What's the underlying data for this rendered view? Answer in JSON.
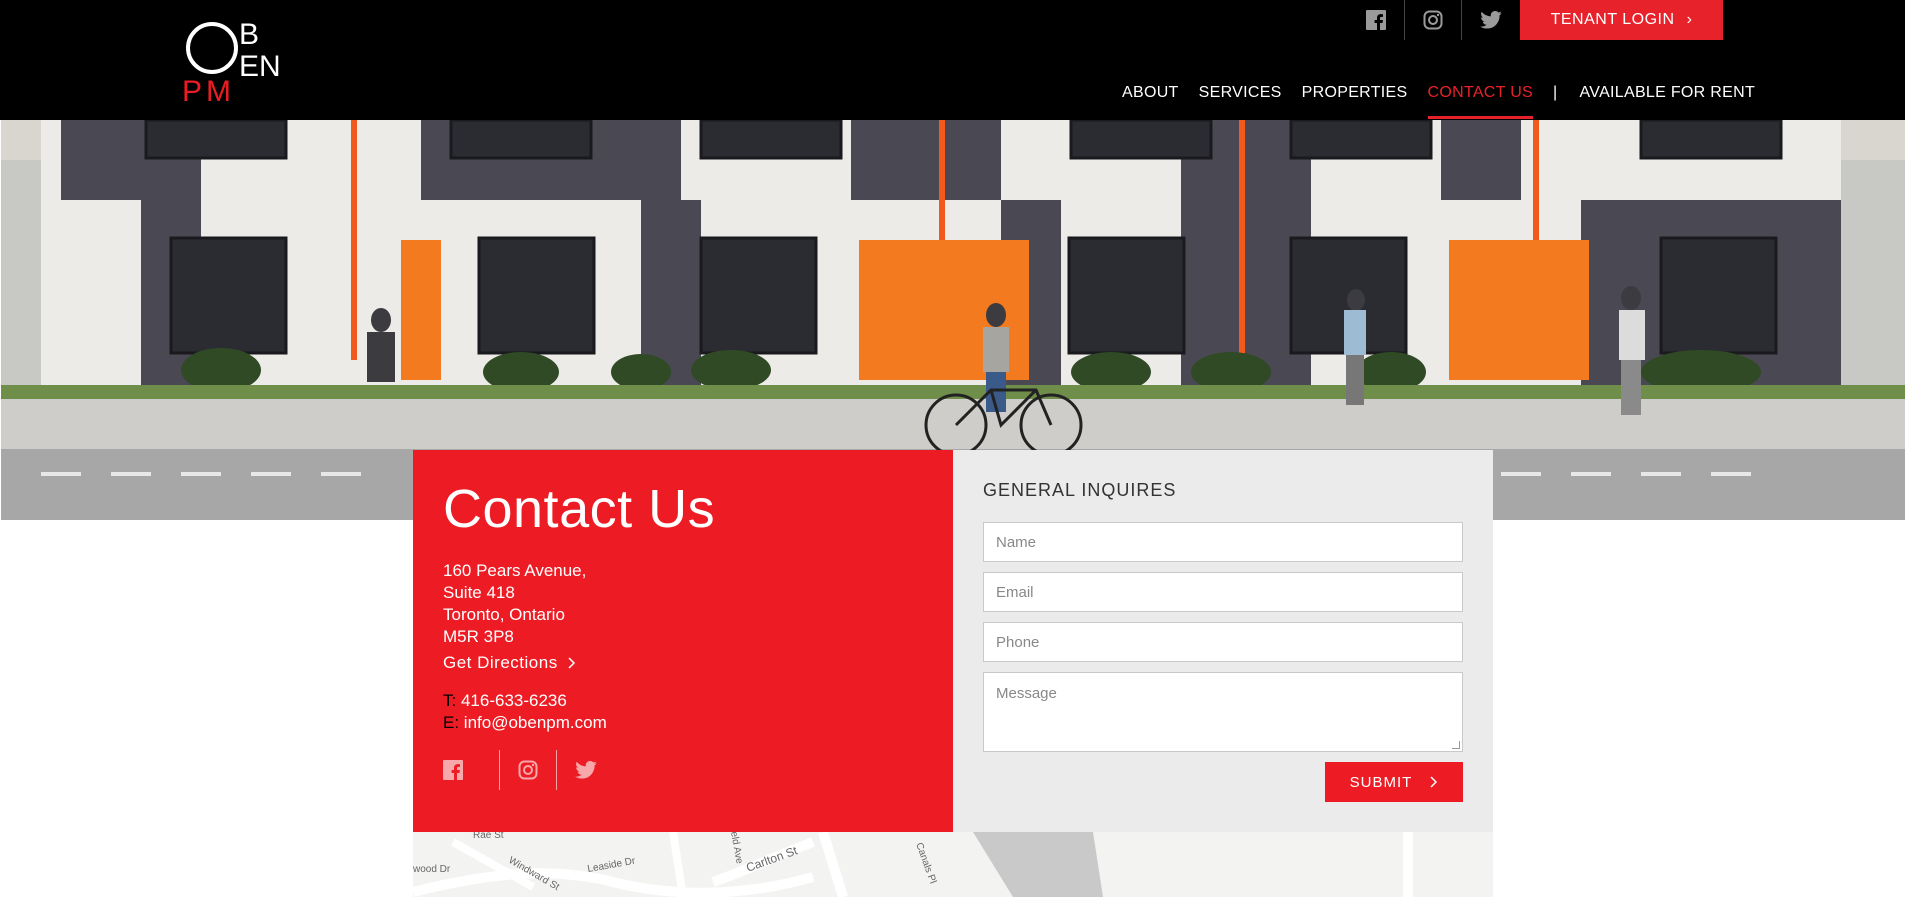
{
  "header": {
    "logo_alt": "OBEN PM",
    "tenant_login": "TENANT LOGIN",
    "social": [
      "facebook-icon",
      "instagram-icon",
      "twitter-icon"
    ],
    "nav": [
      {
        "label": "ABOUT",
        "active": false
      },
      {
        "label": "SERVICES",
        "active": false
      },
      {
        "label": "PROPERTIES",
        "active": false
      },
      {
        "label": "CONTACT US",
        "active": true
      }
    ],
    "nav_separator": "|",
    "nav_extra": "AVAILABLE FOR RENT"
  },
  "contact": {
    "title": "Contact Us",
    "address": [
      "160 Pears Avenue,",
      "Suite 418",
      "Toronto, Ontario",
      "M5R 3P8"
    ],
    "directions": "Get Directions",
    "phone_label": "T:",
    "phone": "416-633-6236",
    "email_label": "E:",
    "email": "info@obenpm.com"
  },
  "form": {
    "heading": "GENERAL INQUIRES",
    "name_placeholder": "Name",
    "email_placeholder": "Email",
    "phone_placeholder": "Phone",
    "message_placeholder": "Message",
    "submit": "SUBMIT"
  },
  "map": {
    "labels": [
      "Rae St",
      "Windward St",
      "Leaside Dr",
      "Carlton St",
      "Canals Pl",
      "wood Dr",
      "eld Ave"
    ]
  },
  "colors": {
    "accent": "#ed1c24",
    "header_bg": "#000000",
    "form_bg": "#ebebeb"
  }
}
